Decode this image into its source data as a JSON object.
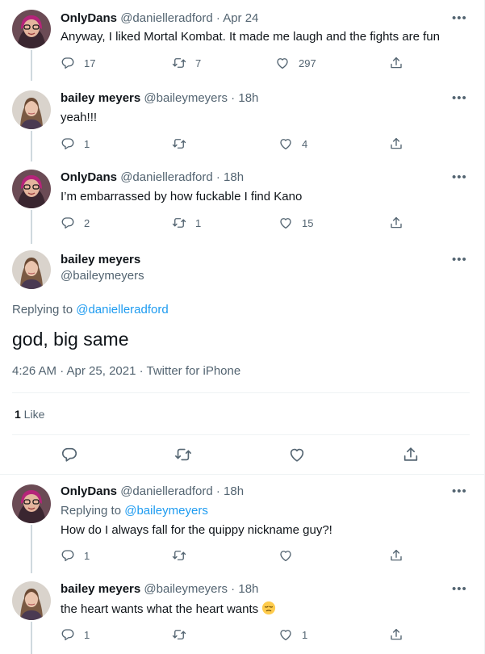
{
  "tweets": [
    {
      "name": "OnlyDans",
      "handle": "@danielleradford",
      "sep": " · ",
      "time": "Apr 24",
      "text": "Anyway, I liked Mortal Kombat. It made me laugh and the fights are fun",
      "replies": "17",
      "retweets": "7",
      "likes": "297"
    },
    {
      "name": "bailey meyers",
      "handle": "@baileymeyers",
      "sep": " · ",
      "time": "18h",
      "text": "yeah!!!",
      "replies": "1",
      "retweets": "",
      "likes": "4"
    },
    {
      "name": "OnlyDans",
      "handle": "@danielleradford",
      "sep": " · ",
      "time": "18h",
      "text": "I’m embarrassed by how fuckable I find Kano",
      "replies": "2",
      "retweets": "1",
      "likes": "15"
    }
  ],
  "main_tweet": {
    "name": "bailey meyers",
    "handle": "@baileymeyers",
    "replying_prefix": "Replying to ",
    "replying_to": "@danielleradford",
    "text": "god, big same",
    "timestamp": "4:26 AM · Apr 25, 2021 · Twitter for iPhone",
    "like_count": "1",
    "like_label": " Like"
  },
  "replies": [
    {
      "name": "OnlyDans",
      "handle": "@danielleradford",
      "sep": " · ",
      "time": "18h",
      "replying_prefix": "Replying to ",
      "replying_to": "@baileymeyers",
      "text": "How do I always fall for the quippy nickname guy?!",
      "replies": "1",
      "retweets": "",
      "likes": ""
    },
    {
      "name": "bailey meyers",
      "handle": "@baileymeyers",
      "sep": " · ",
      "time": "18h",
      "text": "the heart wants what the heart wants",
      "emoji": "pensive-face",
      "replies": "1",
      "retweets": "",
      "likes": "1"
    }
  ],
  "more_label": "•••",
  "icons": {
    "reply": "reply-icon",
    "retweet": "retweet-icon",
    "like": "like-icon",
    "share": "share-icon"
  },
  "colors": {
    "text": "#0f1419",
    "secondary": "#536471",
    "link": "#1d9bf0",
    "border": "#eff3f4",
    "thread_line": "#cfd9de"
  }
}
